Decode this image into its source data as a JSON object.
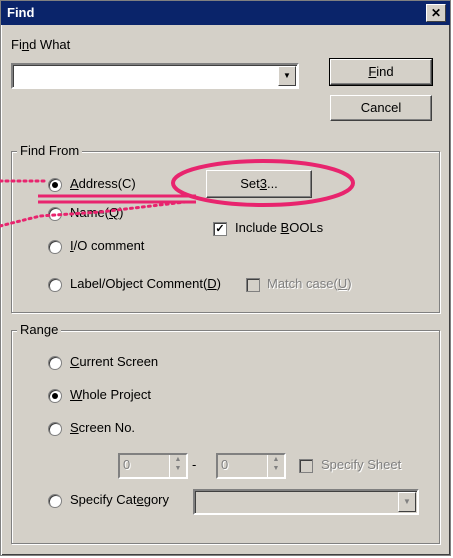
{
  "window": {
    "title": "Find",
    "close_glyph": "✕"
  },
  "find_what": {
    "label_pre": "Fi",
    "label_ul": "n",
    "label_post": "d What",
    "value": "",
    "find_button_ul": "F",
    "find_button_post": "ind",
    "cancel_label": "Cancel"
  },
  "find_from": {
    "title": "Find From",
    "address_pre": "",
    "address_ul": "A",
    "address_post": "ddress(C)",
    "set_pre": "Set",
    "set_ul": "3",
    "set_post": "...",
    "name_pre": "Name(",
    "name_ul": "Q",
    "name_post": ")",
    "include_pre": "Include ",
    "include_ul": "B",
    "include_post": "OOLs",
    "io_pre": "",
    "io_ul": "I",
    "io_post": "/O comment",
    "label_pre": "Label/Object Comment(",
    "label_ul": "D",
    "label_post": ")",
    "match_pre": "Match case(",
    "match_ul": "U",
    "match_post": ")"
  },
  "range": {
    "title": "Range",
    "current_pre": "",
    "current_ul": "C",
    "current_post": "urrent Screen",
    "whole_pre": "",
    "whole_ul": "W",
    "whole_post": "hole Project",
    "screen_pre": "",
    "screen_ul": "S",
    "screen_post": "creen No.",
    "spin_from": "0",
    "spin_to": "0",
    "dash": "-",
    "specify_sheet": "Specify Sheet",
    "category_pre": "Specify Cat",
    "category_ul": "e",
    "category_post": "gory",
    "category_value": ""
  },
  "colors": {
    "highlight": "#e8246e",
    "title_bar": "#0a246a",
    "face": "#d4d0c8"
  }
}
